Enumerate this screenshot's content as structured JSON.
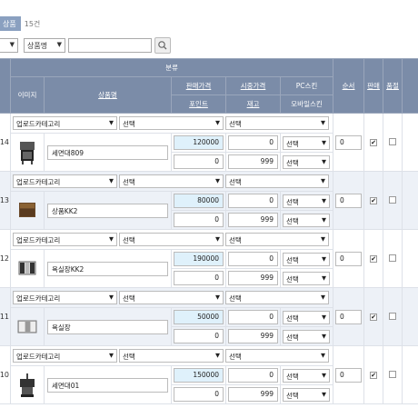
{
  "tabs": {
    "active_label": "상품",
    "count_label": "15건"
  },
  "filters": {
    "category_select": "",
    "field_select": "상품명",
    "search_value": ""
  },
  "table": {
    "headers": {
      "group": "분류",
      "image": "이미지",
      "name": "상품명",
      "sale_price": "판매가격",
      "market_price": "시중가격",
      "pc_skin": "PC스킨",
      "order": "순서",
      "sale": "판매",
      "soldout": "품절",
      "point": "포인트",
      "stock": "재고",
      "mobile_skin": "모바일스킨"
    },
    "rows": [
      {
        "no": "14",
        "category": "업로드카테고리",
        "sub1": "선택",
        "sub2": "선택",
        "name": "세면대809",
        "price": "120000",
        "market": "0",
        "point": "0",
        "stock": "999",
        "pc_skin": "선택",
        "mobile_skin": "선택",
        "order": "0",
        "sale_checked": true,
        "soldout_checked": false
      },
      {
        "no": "13",
        "category": "업로드카테고리",
        "sub1": "선택",
        "sub2": "선택",
        "name": "상품KK2",
        "price": "80000",
        "market": "0",
        "point": "0",
        "stock": "999",
        "pc_skin": "선택",
        "mobile_skin": "선택",
        "order": "0",
        "sale_checked": true,
        "soldout_checked": false
      },
      {
        "no": "12",
        "category": "업로드카테고리",
        "sub1": "선택",
        "sub2": "선택",
        "name": "욕실장KK2",
        "price": "190000",
        "market": "0",
        "point": "0",
        "stock": "999",
        "pc_skin": "선택",
        "mobile_skin": "선택",
        "order": "0",
        "sale_checked": true,
        "soldout_checked": false
      },
      {
        "no": "11",
        "category": "업로드카테고리",
        "sub1": "선택",
        "sub2": "선택",
        "name": "욕실장",
        "price": "50000",
        "market": "0",
        "point": "0",
        "stock": "999",
        "pc_skin": "선택",
        "mobile_skin": "선택",
        "order": "0",
        "sale_checked": true,
        "soldout_checked": false
      },
      {
        "no": "10",
        "category": "업로드카테고리",
        "sub1": "선택",
        "sub2": "선택",
        "name": "세면대01",
        "price": "150000",
        "market": "0",
        "point": "0",
        "stock": "999",
        "pc_skin": "선택",
        "mobile_skin": "선택",
        "order": "0",
        "sale_checked": true,
        "soldout_checked": false
      }
    ]
  },
  "icons": {
    "search": "search-icon",
    "dropdown": "chevron-down-icon",
    "check": "check-icon"
  }
}
